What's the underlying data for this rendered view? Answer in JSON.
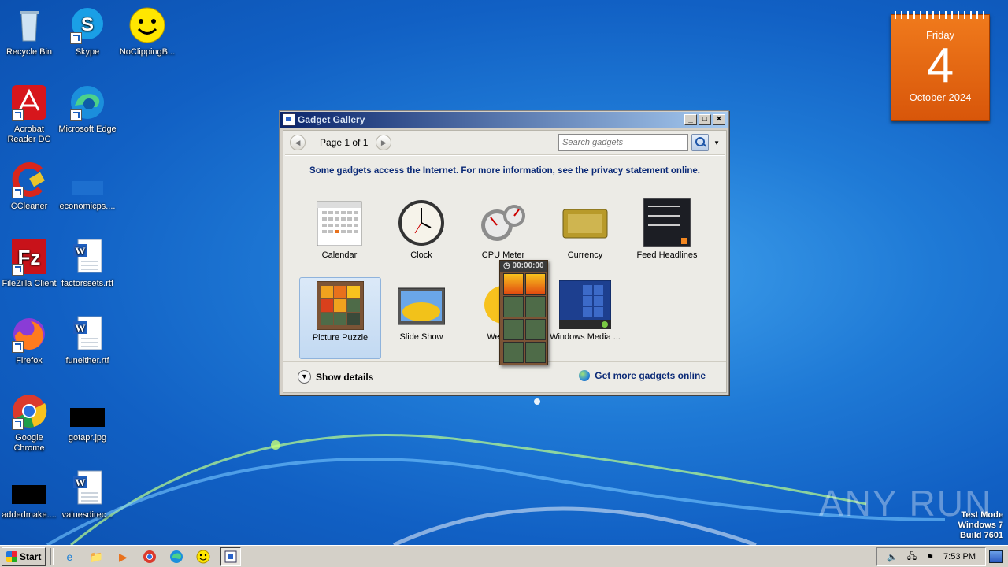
{
  "desktop": {
    "icons": [
      {
        "label": "Recycle Bin",
        "icon": "recycle-bin-icon"
      },
      {
        "label": "Skype",
        "icon": "skype-icon"
      },
      {
        "label": "NoClippingB...",
        "icon": "smiley-icon"
      },
      {
        "label": "Acrobat Reader DC",
        "icon": "acrobat-icon"
      },
      {
        "label": "Microsoft Edge",
        "icon": "edge-icon"
      },
      {
        "label": "CCleaner",
        "icon": "ccleaner-icon"
      },
      {
        "label": "economicps....",
        "icon": "blank-file-icon"
      },
      {
        "label": "FileZilla Client",
        "icon": "filezilla-icon"
      },
      {
        "label": "factorssets.rtf",
        "icon": "word-doc-icon"
      },
      {
        "label": "Firefox",
        "icon": "firefox-icon"
      },
      {
        "label": "funeither.rtf",
        "icon": "word-doc-icon"
      },
      {
        "label": "Google Chrome",
        "icon": "chrome-icon"
      },
      {
        "label": "gotapr.jpg",
        "icon": "image-file-icon"
      },
      {
        "label": "addedmake....",
        "icon": "image-file-icon"
      },
      {
        "label": "valuesdirec...",
        "icon": "word-doc-icon"
      }
    ]
  },
  "calendar_gadget": {
    "day": "Friday",
    "date": "4",
    "month": "October 2024"
  },
  "window": {
    "title": "Gadget Gallery",
    "buttons": {
      "minimize": "_",
      "maximize": "□",
      "close": "✕"
    },
    "page_label": "Page 1 of 1",
    "search_placeholder": "Search gadgets",
    "notice": "Some gadgets access the Internet.  For more information, see the privacy statement online.",
    "gadgets": [
      {
        "label": "Calendar",
        "icon": "calendar-gadget-icon"
      },
      {
        "label": "Clock",
        "icon": "clock-gadget-icon"
      },
      {
        "label": "CPU Meter",
        "icon": "cpu-meter-icon"
      },
      {
        "label": "Currency",
        "icon": "currency-icon"
      },
      {
        "label": "Feed Headlines",
        "icon": "feed-headlines-icon"
      },
      {
        "label": "Picture Puzzle",
        "icon": "picture-puzzle-icon"
      },
      {
        "label": "Slide Show",
        "icon": "slide-show-icon"
      },
      {
        "label": "Weather",
        "icon": "weather-icon"
      },
      {
        "label": "Windows Media ...",
        "icon": "windows-media-icon"
      }
    ],
    "show_details": "Show details",
    "get_more": "Get more gadgets online"
  },
  "drag_puzzle": {
    "timer": "00:00:00"
  },
  "taskbar": {
    "start_label": "Start",
    "clock": "7:53 PM"
  },
  "watermark": "ANY RUN",
  "test_mode": {
    "line1": "Test Mode",
    "line2": "Windows 7",
    "line3": "Build 7601"
  }
}
